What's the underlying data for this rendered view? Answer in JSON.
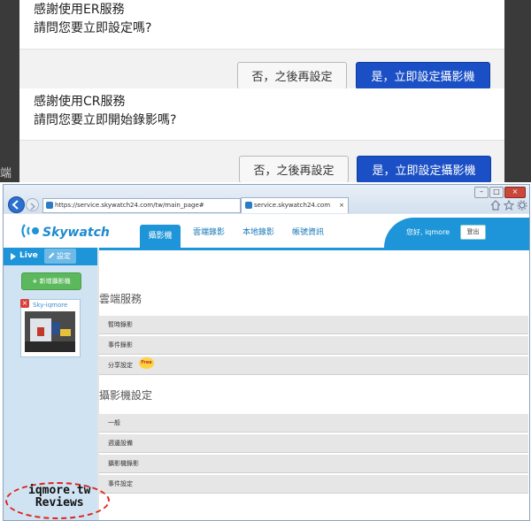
{
  "dialog_er": {
    "line1": "感謝使用ER服務",
    "line2": "請問您要立即設定嗎?",
    "btn_later": "否，之後再設定",
    "btn_now": "是，立即設定攝影機"
  },
  "dialog_cr": {
    "line1": "感謝使用CR服務",
    "line2": "請問您要立即開始錄影嗎?",
    "btn_later": "否，之後再設定",
    "btn_now": "是，立即設定攝影機",
    "partial_text": "端"
  },
  "browser": {
    "url": "https://service.skywatch24.com/tw/main_page#",
    "tab_title": "service.skywatch24.com",
    "tab_close": "×"
  },
  "site": {
    "logo_text": "Skywatch",
    "nav": [
      "攝影機",
      "雲端錄影",
      "本地錄影",
      "帳號資訊"
    ],
    "greeting": "您好, iqmore",
    "logout": "登出",
    "live_label": "Live",
    "settings_label": "設定",
    "add_camera": "新增攝影機",
    "camera_name": "Sky-iqmore",
    "cloud_section": "雲端服務",
    "cloud_rows": [
      "暫時錄影",
      "事件錄影",
      "分享設定"
    ],
    "free_badge": "Free",
    "camera_section": "攝影機設定",
    "camera_rows": [
      "一般",
      "週邊設備",
      "攝影機錄影",
      "事件設定"
    ]
  },
  "watermark": {
    "line1": "iqmore.tw",
    "line2": "Reviews"
  },
  "colors": {
    "primary_blue": "#1a4fc5",
    "brand_blue": "#1d95d8",
    "green": "#5cb85c"
  }
}
